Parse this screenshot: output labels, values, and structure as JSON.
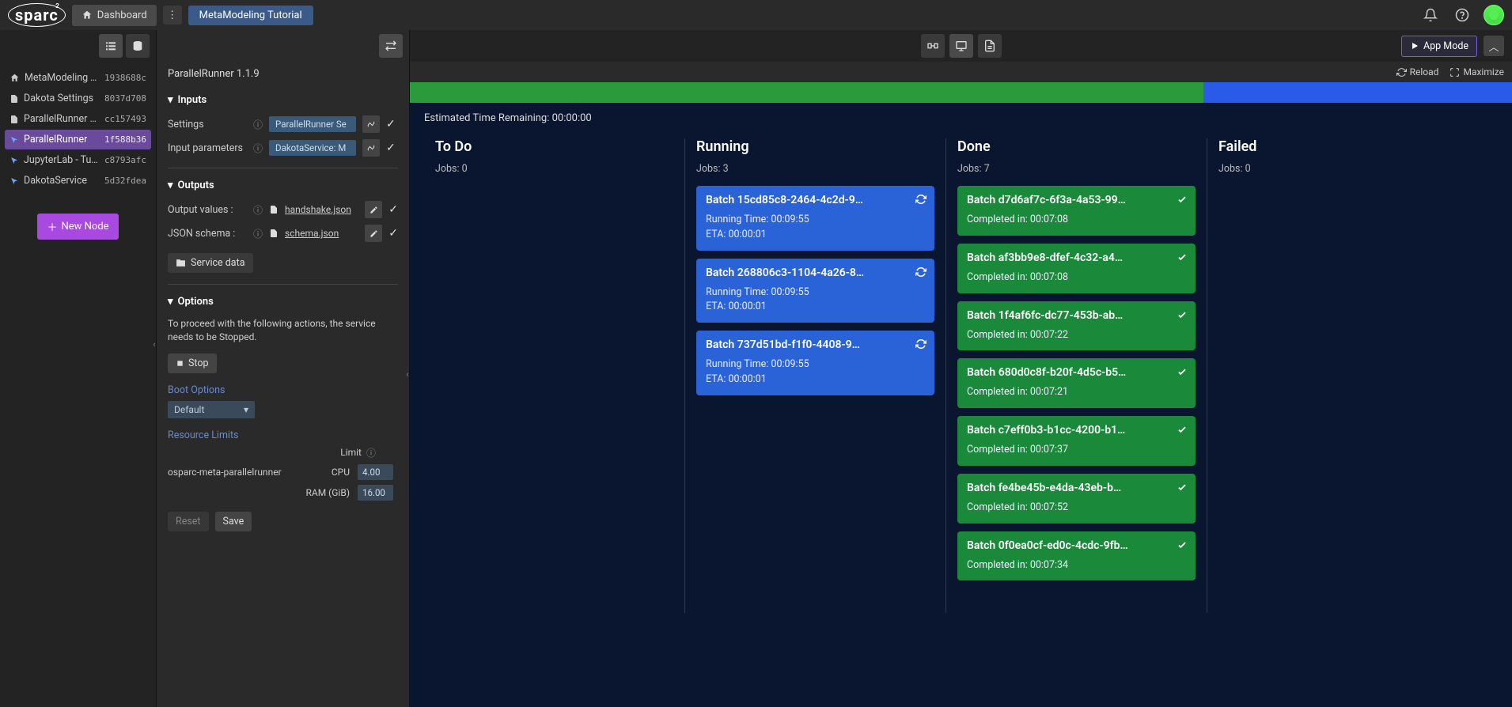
{
  "header": {
    "dashboard": "Dashboard",
    "title": "MetaModeling Tutorial"
  },
  "sidebar": {
    "nodes": [
      {
        "icon": "home",
        "name": "MetaModeling T…",
        "id": "1938688c"
      },
      {
        "icon": "file",
        "name": "Dakota Settings",
        "id": "8037d708"
      },
      {
        "icon": "file",
        "name": "ParallelRunner S…",
        "id": "cc157493"
      },
      {
        "icon": "cursor",
        "name": "ParallelRunner",
        "id": "1f588b36",
        "selected": true
      },
      {
        "icon": "cursor",
        "name": "JupyterLab - Tut…",
        "id": "c8793afc"
      },
      {
        "icon": "cursor",
        "name": "DakotaService",
        "id": "5d32fdea"
      }
    ],
    "new_node": "New Node"
  },
  "panel": {
    "title": "ParallelRunner 1.1.9",
    "inputs_header": "Inputs",
    "inputs": [
      {
        "label": "Settings",
        "chip": "ParallelRunner Se"
      },
      {
        "label": "Input parameters",
        "chip": "DakotaService: M"
      }
    ],
    "outputs_header": "Outputs",
    "outputs": [
      {
        "label": "Output values :",
        "file": "handshake.json"
      },
      {
        "label": "JSON schema :",
        "file": "schema.json"
      }
    ],
    "service_data": "Service data",
    "options_header": "Options",
    "options_text": "To proceed with the following actions, the service needs to be Stopped.",
    "stop": "Stop",
    "boot_label": "Boot Options",
    "boot_value": "Default",
    "res_label": "Resource Limits",
    "limit_label": "Limit",
    "res_name": "osparc-meta-parallelrunner",
    "cpu_label": "CPU",
    "cpu_value": "4.00",
    "ram_label": "RAM (GiB)",
    "ram_value": "16.00",
    "reset": "Reset",
    "save": "Save"
  },
  "toolbar": {
    "app_mode": "App Mode",
    "reload": "Reload",
    "maximize": "Maximize"
  },
  "runner": {
    "eta": "Estimated Time Remaining: 00:00:00",
    "columns": [
      {
        "title": "To Do",
        "count": "Jobs: 0",
        "cards": []
      },
      {
        "title": "Running",
        "count": "Jobs: 3",
        "kind": "blue",
        "cards": [
          {
            "title": "Batch 15cd85c8-2464-4c2d-9…",
            "l1": "Running Time: 00:09:55",
            "l2": "ETA: 00:00:01",
            "icon": "refresh"
          },
          {
            "title": "Batch 268806c3-1104-4a26-8…",
            "l1": "Running Time: 00:09:55",
            "l2": "ETA: 00:00:01",
            "icon": "refresh"
          },
          {
            "title": "Batch 737d51bd-f1f0-4408-9…",
            "l1": "Running Time: 00:09:55",
            "l2": "ETA: 00:00:01",
            "icon": "refresh"
          }
        ]
      },
      {
        "title": "Done",
        "count": "Jobs: 7",
        "kind": "green",
        "cards": [
          {
            "title": "Batch d7d6af7c-6f3a-4a53-99…",
            "l1": "Completed in: 00:07:08",
            "icon": "check"
          },
          {
            "title": "Batch af3bb9e8-dfef-4c32-a4…",
            "l1": "Completed in: 00:07:08",
            "icon": "check"
          },
          {
            "title": "Batch 1f4af6fc-dc77-453b-ab…",
            "l1": "Completed in: 00:07:22",
            "icon": "check"
          },
          {
            "title": "Batch 680d0c8f-b20f-4d5c-b5…",
            "l1": "Completed in: 00:07:21",
            "icon": "check"
          },
          {
            "title": "Batch c7eff0b3-b1cc-4200-b1…",
            "l1": "Completed in: 00:07:37",
            "icon": "check"
          },
          {
            "title": "Batch fe4be45b-e4da-43eb-b…",
            "l1": "Completed in: 00:07:52",
            "icon": "check"
          },
          {
            "title": "Batch 0f0ea0cf-ed0c-4cdc-9fb…",
            "l1": "Completed in: 00:07:34",
            "icon": "check"
          }
        ]
      },
      {
        "title": "Failed",
        "count": "Jobs: 0",
        "cards": []
      }
    ]
  }
}
